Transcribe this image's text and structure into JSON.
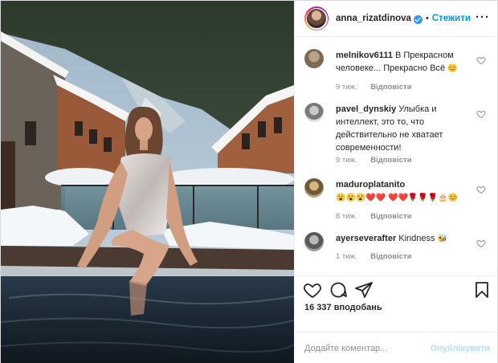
{
  "post": {
    "username": "anna_rizatdinova",
    "separator": "•",
    "follow_label": "Стежити",
    "more_icon": "more-horizontal-icon"
  },
  "comments": [
    {
      "username": "melnikov6111",
      "text": "В Прекрасном человеке... Прекрасно Всё",
      "emoji": "😊",
      "time": "9 тиж.",
      "reply": "Відповісти"
    },
    {
      "username": "pavel_dynskiy",
      "text": "Улыбка и интеллект, это то, что действительно не хватает современности!",
      "emoji": "",
      "time": "9 тиж.",
      "reply": "Відповісти"
    },
    {
      "username": "maduroplatanito",
      "text": "",
      "emoji": "😮😮😮❤️❤️ ❤️❤️🌹🌹🌹🎂😊",
      "time": "8 тиж.",
      "reply": "Відповісти"
    },
    {
      "username": "ayerseverafter",
      "text": "Kindness",
      "emoji": "🐝",
      "time": "1 тиж.",
      "reply": "Відповісти"
    }
  ],
  "actions": {
    "like_icon": "heart-icon",
    "comment_icon": "comment-icon",
    "share_icon": "send-icon",
    "save_icon": "bookmark-icon",
    "likes": "16 337 вподобань"
  },
  "add_comment": {
    "placeholder": "Додайте коментар...",
    "publish_label": "Опублікувати"
  },
  "colors": {
    "accent": "#0095f6",
    "publish_disabled": "#b2dffc",
    "meta": "#8e8e8e",
    "text": "#262626"
  }
}
